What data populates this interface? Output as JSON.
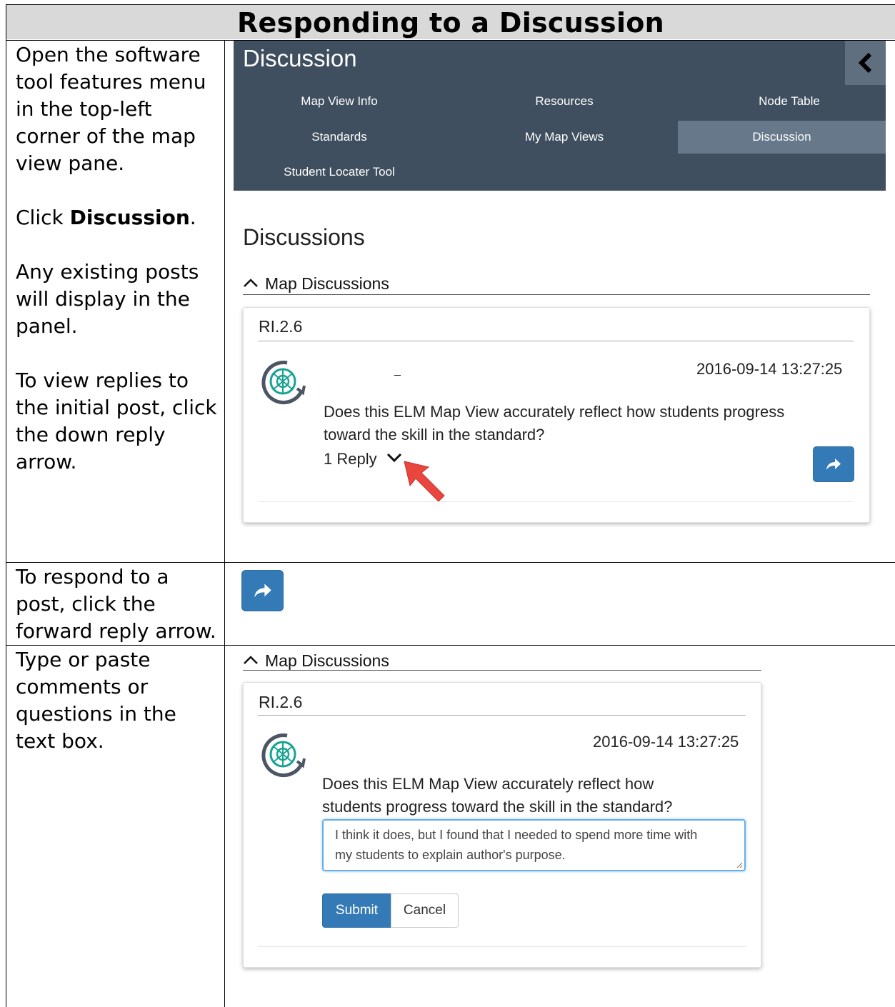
{
  "title": "Responding to a Discussion",
  "instructions": {
    "step1_p1": "Open the software tool features menu in the top-left corner of the map view pane.",
    "step1_click_prefix": "Click ",
    "step1_click_bold": "Discussion",
    "step1_click_suffix": ".",
    "step1_p3": "Any existing posts will display in the panel.",
    "step1_p4": "To view replies to the initial post, click the down reply arrow.",
    "step2": "To respond to a post, click the forward reply arrow.",
    "step3": "Type or paste comments or questions in the text box."
  },
  "menu": {
    "title": "Discussion",
    "items": [
      "Map View Info",
      "Resources",
      "Node Table",
      "Standards",
      "My Map Views",
      "Discussion",
      "Student Locater Tool"
    ],
    "active_item": "Discussion"
  },
  "panel1": {
    "heading": "Discussions",
    "section": "Map Discussions",
    "card_title": "RI.2.6",
    "timestamp": "2016-09-14 13:27:25",
    "author": "_",
    "post_line1": "Does this ELM Map View accurately reflect how students progress",
    "post_line2": "toward the skill in the standard?",
    "reply_count": "1 Reply"
  },
  "panel2": {
    "section": "Map Discussions",
    "card_title": "RI.2.6",
    "timestamp": "2016-09-14 13:27:25",
    "post_line1": "Does this ELM Map View accurately reflect how",
    "post_line2": "students progress toward the skill in the standard?",
    "reply_text_line1": "I think it does, but I found that I needed to spend more time with",
    "reply_text_line2": "my students to explain author's purpose.",
    "submit_label": "Submit",
    "cancel_label": "Cancel"
  },
  "colors": {
    "menu_bg": "#3f4f5f",
    "accent_blue": "#337ab7",
    "arrow_red": "#e8463e",
    "title_bg": "#d9d9d9"
  }
}
